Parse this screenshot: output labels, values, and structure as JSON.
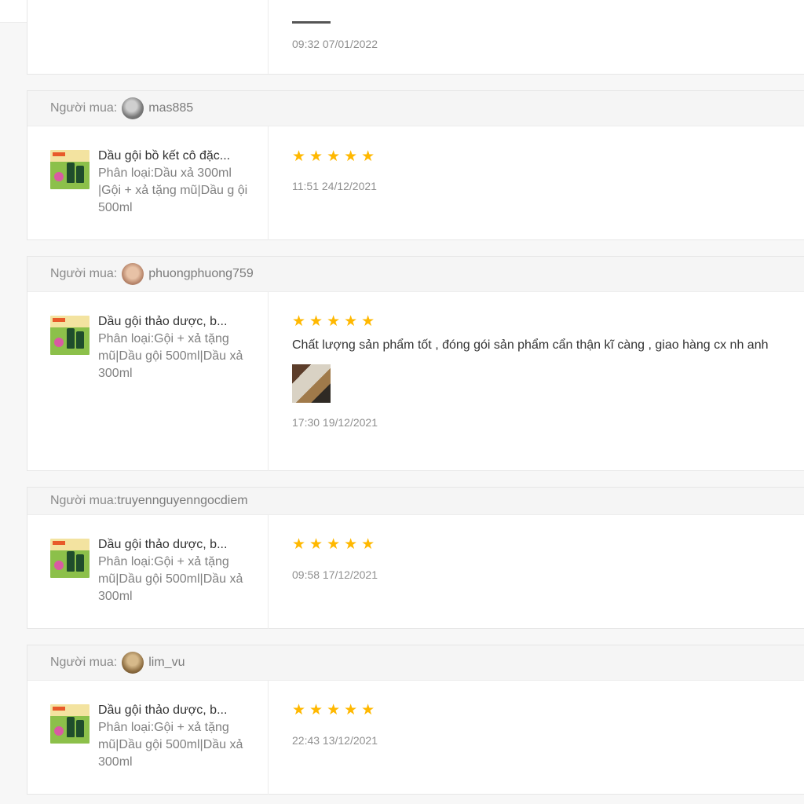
{
  "buyer_label": "Người mua:",
  "previous_review": {
    "time": "09:32 07/01/2022"
  },
  "reviews": [
    {
      "username": "mas885",
      "product_name": "Dầu gội bồ kết cô đặc...",
      "variant": "Phân loại:Dầu xả 300ml |Gội + xả tặng mũ|Dầu g ội 500ml",
      "rating": 5,
      "stars": "★★★★★",
      "time": "11:51 24/12/2021"
    },
    {
      "username": "phuongphuong759",
      "product_name": "Dầu gội thảo dược, b...",
      "variant": "Phân loại:Gội + xả tặng mũ|Dầu gội 500ml|Dầu xả 300ml",
      "rating": 5,
      "stars": "★★★★★",
      "comment": "Chất lượng sản phẩm tốt , đóng gói sản phẩm cẩn thận kĩ càng , giao hàng cx nh anh",
      "time": "17:30 19/12/2021"
    },
    {
      "username": "truyennguyenngocdiem",
      "product_name": "Dầu gội thảo dược, b...",
      "variant": "Phân loại:Gội + xả tặng mũ|Dầu gội 500ml|Dầu xả 300ml",
      "rating": 5,
      "stars": "★★★★★",
      "time": "09:58 17/12/2021"
    },
    {
      "username": "lim_vu",
      "product_name": "Dầu gội thảo dược, b...",
      "variant": "Phân loại:Gội + xả tặng mũ|Dầu gội 500ml|Dầu xả 300ml",
      "rating": 5,
      "stars": "★★★★★",
      "time": "22:43 13/12/2021"
    }
  ],
  "colors": {
    "star": "#ffb800",
    "header_bg": "#f5f5f5",
    "border": "#e6e6e6"
  }
}
